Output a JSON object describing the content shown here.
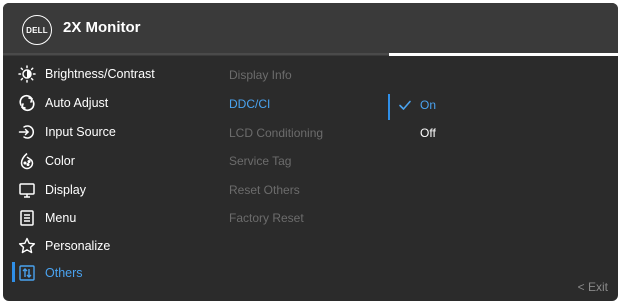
{
  "header": {
    "logo_text": "DELL",
    "title": "2X Monitor"
  },
  "sidebar": {
    "items": [
      {
        "label": "Brightness/Contrast",
        "icon": "brightness-icon"
      },
      {
        "label": "Auto Adjust",
        "icon": "auto-adjust-icon"
      },
      {
        "label": "Input Source",
        "icon": "input-source-icon"
      },
      {
        "label": "Color",
        "icon": "color-palette-icon"
      },
      {
        "label": "Display",
        "icon": "display-icon"
      },
      {
        "label": "Menu",
        "icon": "menu-icon"
      },
      {
        "label": "Personalize",
        "icon": "star-icon"
      },
      {
        "label": "Others",
        "icon": "others-icon",
        "selected": true
      }
    ]
  },
  "submenu": {
    "items": [
      {
        "label": "Display Info"
      },
      {
        "label": "DDC/CI",
        "active": true
      },
      {
        "label": "LCD Conditioning"
      },
      {
        "label": "Service Tag"
      },
      {
        "label": "Reset Others"
      },
      {
        "label": "Factory Reset"
      }
    ]
  },
  "options": {
    "on_label": "On",
    "off_label": "Off",
    "selected": "On"
  },
  "footer": {
    "exit_label": "< Exit"
  },
  "colors": {
    "accent": "#2f8fe8",
    "background": "#2b2b2b",
    "header": "#3a3a3a",
    "disabled_text": "#6c6c6c"
  }
}
